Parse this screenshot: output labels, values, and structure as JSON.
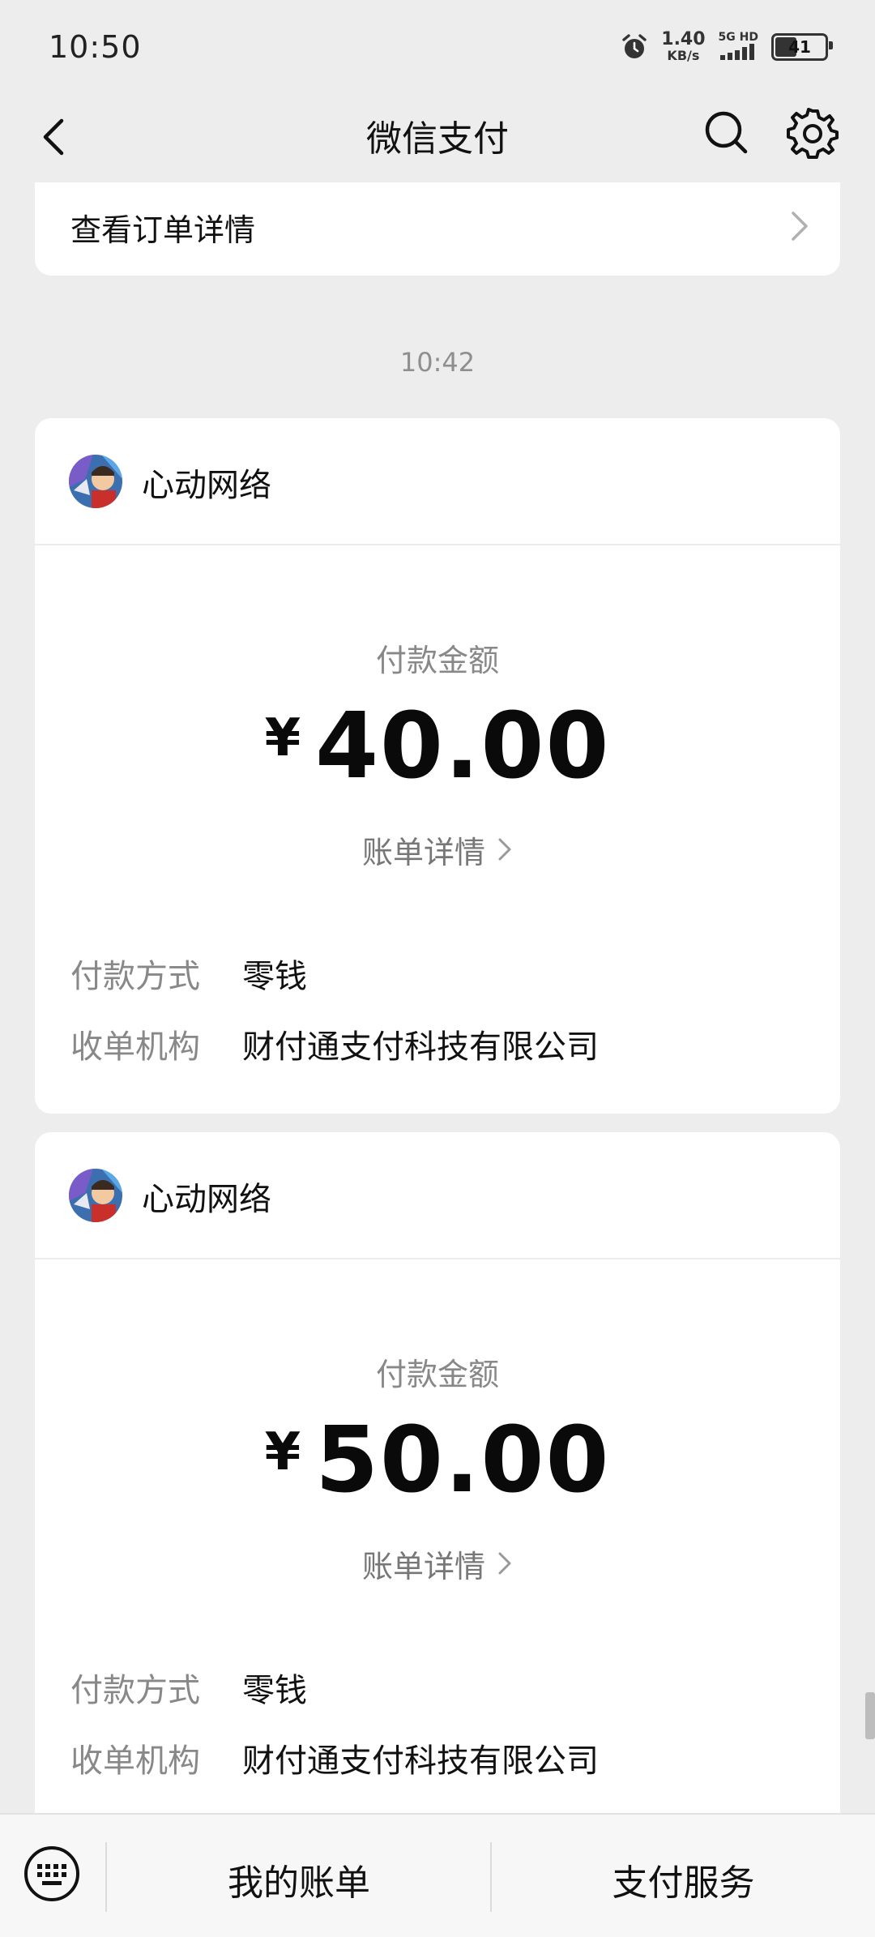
{
  "status_bar": {
    "time": "10:50",
    "net_speed_value": "1.40",
    "net_speed_unit": "KB/s",
    "network_label": "5G HD",
    "battery_level": "41"
  },
  "nav": {
    "title": "微信支付"
  },
  "order": {
    "label": "查看订单详情"
  },
  "timestamp": "10:42",
  "payments": [
    {
      "merchant": "心动网络",
      "amount_label": "付款金额",
      "currency": "¥",
      "amount": "40.00",
      "bill_link": "账单详情",
      "method_key": "付款方式",
      "method_value": "零钱",
      "acquirer_key": "收单机构",
      "acquirer_value": "财付通支付科技有限公司"
    },
    {
      "merchant": "心动网络",
      "amount_label": "付款金额",
      "currency": "¥",
      "amount": "50.00",
      "bill_link": "账单详情",
      "method_key": "付款方式",
      "method_value": "零钱",
      "acquirer_key": "收单机构",
      "acquirer_value": "财付通支付科技有限公司"
    }
  ],
  "bottom_bar": {
    "my_bills": "我的账单",
    "pay_services": "支付服务"
  },
  "icons": {
    "back": "back-arrow-icon",
    "search": "search-icon",
    "settings": "gear-icon",
    "keyboard": "keyboard-icon"
  }
}
